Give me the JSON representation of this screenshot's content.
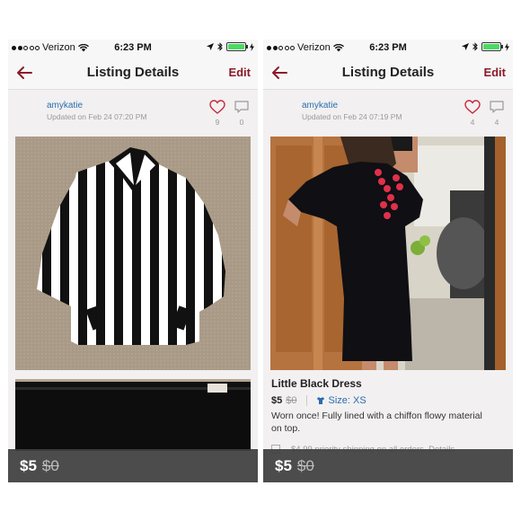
{
  "status_bar": {
    "carrier": "Verizon",
    "time": "6:23 PM",
    "battery_level": 1.0
  },
  "nav": {
    "title": "Listing Details",
    "edit_label": "Edit",
    "back_icon": "back-arrow-icon"
  },
  "left": {
    "seller": "amykatie",
    "updated": "Updated on Feb 24 07:20 PM",
    "likes": "9",
    "comments": "0",
    "price": "$5",
    "original_price": "$0"
  },
  "right": {
    "seller": "amykatie",
    "updated": "Updated on Feb 24 07:19 PM",
    "likes": "4",
    "comments": "4",
    "title": "Little Black Dress",
    "price": "$5",
    "original_price": "$0",
    "size": "Size: XS",
    "description": "Worn once! Fully lined with a chiffon flowy material on top.",
    "shipping_note": "$4.99 priority shipping on all orders. Details",
    "footer_price": "$5",
    "footer_original_price": "$0"
  },
  "colors": {
    "accent": "#8b1a2b",
    "link": "#2a6db0",
    "battery": "#4cd964"
  }
}
